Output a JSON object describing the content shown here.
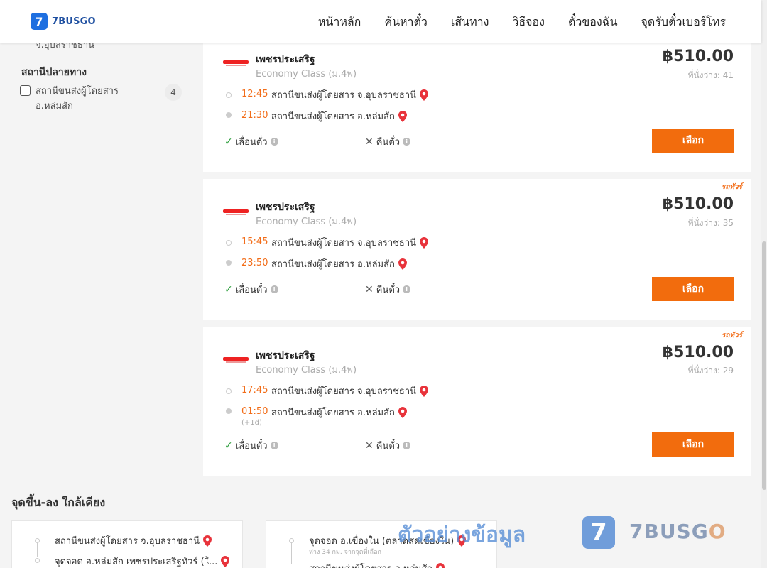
{
  "header": {
    "logo_mark": "7",
    "logo_text": "7BUSGO",
    "nav": [
      "หน้าหลัก",
      "ค้นหาตั๋ว",
      "เส้นทาง",
      "วิธีจอง",
      "ตั๋วของฉัน",
      "จุดรับตั๋วเบอร์โทร"
    ]
  },
  "sidebar": {
    "cut_text": "จ.อุบลราชธานี",
    "heading": "สถานีปลายทาง",
    "filters": [
      {
        "label": "สถานีขนส่งผู้โดยสาร อ.หล่มสัก",
        "count": "4",
        "checked": false
      }
    ]
  },
  "trips": [
    {
      "operator": "เพชรประเสริฐ",
      "class": "Economy Class (ม.4พ)",
      "price": "฿510.00",
      "seats": "ที่นั่งว่าง: 41",
      "tag": "",
      "depart_time": "12:45",
      "depart_station": "สถานีขนส่งผู้โดยสาร จ.อุบลราชธานี",
      "arrive_time": "21:30",
      "arrive_station": "สถานีขนส่งผู้โดยสาร อ.หล่มสัก",
      "next_day": "",
      "feature_yes": "เลื่อนตั๋ว",
      "feature_no": "คืนตั๋ว",
      "button": "เลือก"
    },
    {
      "operator": "เพชรประเสริฐ",
      "class": "Economy Class (ม.4พ)",
      "price": "฿510.00",
      "seats": "ที่นั่งว่าง: 35",
      "tag": "รถทัวร์",
      "depart_time": "15:45",
      "depart_station": "สถานีขนส่งผู้โดยสาร จ.อุบลราชธานี",
      "arrive_time": "23:50",
      "arrive_station": "สถานีขนส่งผู้โดยสาร อ.หล่มสัก",
      "next_day": "",
      "feature_yes": "เลื่อนตั๋ว",
      "feature_no": "คืนตั๋ว",
      "button": "เลือก"
    },
    {
      "operator": "เพชรประเสริฐ",
      "class": "Economy Class (ม.4พ)",
      "price": "฿510.00",
      "seats": "ที่นั่งว่าง: 29",
      "tag": "รถทัวร์",
      "depart_time": "17:45",
      "depart_station": "สถานีขนส่งผู้โดยสาร จ.อุบลราชธานี",
      "arrive_time": "01:50",
      "arrive_station": "สถานีขนส่งผู้โดยสาร อ.หล่มสัก",
      "next_day": "(+1d)",
      "feature_yes": "เลื่อนตั๋ว",
      "feature_no": "คืนตั๋ว",
      "button": "เลือก"
    }
  ],
  "nearby": {
    "title": "จุดขึ้น-ลง ใกล้เคียง",
    "cards": [
      {
        "row1": "สถานีขนส่งผู้โดยสาร จ.อุบลราชธานี",
        "row1_sub": "",
        "row2": "จุดจอด อ.หล่มสัก เพชรประเสริฐทัวร์ (ใ..."
      },
      {
        "row1": "จุดจอด อ.เขื่องใน (ตลาดสดเขื่องใน)",
        "row1_sub": "ห่าง 34 กม. จากจุดที่เลือก",
        "row2": "สถานีขนส่งผู้โดยสาร อ.หล่มสัก"
      }
    ]
  },
  "watermark": {
    "text": "ตัวอย่างข้อมูล",
    "mark": "7",
    "brand_a": "7BUSG",
    "brand_b": "O"
  },
  "colors": {
    "accent": "#f26c0d",
    "time": "#f26c17",
    "pin": "#e8333b",
    "brand": "#1e6fe0"
  }
}
